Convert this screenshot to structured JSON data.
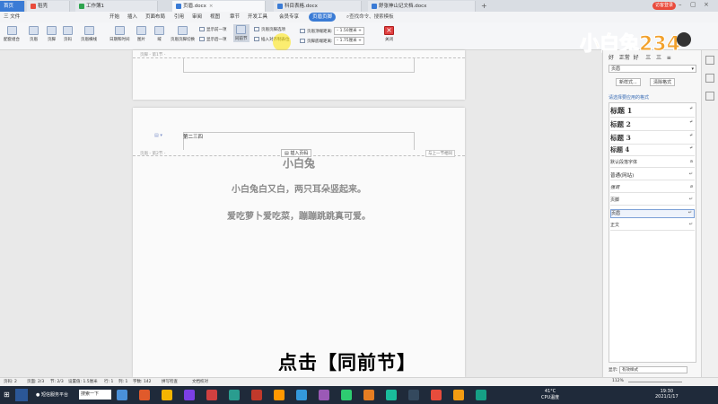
{
  "tabs": [
    {
      "label": "首页",
      "active": false,
      "color": "#3a7bd5"
    },
    {
      "label": "稻壳",
      "active": false,
      "color": "#e94b3c"
    },
    {
      "label": "工作簿1",
      "active": false,
      "color": "#2ea44f"
    },
    {
      "label": "页眉.docx",
      "active": true,
      "color": "#3a7bd5"
    },
    {
      "label": "科目表格.docx",
      "active": false,
      "color": "#3a7bd5"
    },
    {
      "label": "舒张神山记文档.docx",
      "active": false,
      "color": "#3a7bd5"
    }
  ],
  "user_badge": "访客登录",
  "menus": [
    "三 文件",
    "开始",
    "插入",
    "页面布局",
    "引用",
    "审阅",
    "视图",
    "章节",
    "开发工具",
    "会员专享",
    "页眉页脚"
  ],
  "search_placeholder": "查找命令、搜索模板",
  "ribbon": {
    "big": [
      "配套组合",
      "页眉",
      "页脚",
      "页码",
      "页眉横线",
      "日期和时间",
      "图片",
      "域",
      "页眉页脚切换",
      "同前节",
      "关闭"
    ],
    "show_prev": "显示前一项",
    "show_next": "显示后一项",
    "hf_options": "页眉页脚选项",
    "insert_align": "插入对齐制表位",
    "header_top_label": "页眉顶端距离:",
    "header_top_value": "1.50厘米",
    "footer_bottom_label": "页脚底端距离:",
    "footer_bottom_value": "1.75厘米"
  },
  "doc": {
    "footer_label_1": "页脚 - 第1节 -",
    "header_label_2": "页眉 - 第2节 -",
    "header_text": "第二三四",
    "insert_page_num": "插入页码",
    "same_as_prev": "与上一节相同",
    "title": "小白兔",
    "lines": [
      "小白兔白又白，两只耳朵竖起来。",
      "爱吃萝卜爱吃菜，蹦蹦跳跳真可爱。"
    ]
  },
  "panel": {
    "top_labels": [
      "好",
      "正常",
      "好",
      "三",
      "三",
      "≡"
    ],
    "style_select": "页眉",
    "new_style": "新样式...",
    "clear_format": "清除格式",
    "section_title": "请选择要应用的格式",
    "styles": [
      "标题 1",
      "标题 2",
      "标题 3",
      "标题 4",
      "默认段落字体",
      "普通(网站)",
      "强调",
      "页脚",
      "页眉",
      "正文"
    ],
    "show_label": "显示:",
    "show_value": "有效样式"
  },
  "logo_text": "小白兔234",
  "status": [
    "页码: 2",
    "页面: 2/3",
    "节: 2/3",
    "设置值: 1.5厘米",
    "行: 1",
    "列: 1",
    "字数: 142",
    "拼写检查",
    "文档校对"
  ],
  "zoom": "112%",
  "caption": "点击【同前节】",
  "taskbar": {
    "search_text": "搜索一下",
    "app_text": "短信服务平台",
    "temp": "41°C",
    "temp_label": "CPU温度",
    "time": "19:30",
    "date": "2021/1/17",
    "icon_colors": [
      "#4a90d9",
      "#e05a2b",
      "#f4b400",
      "#7b3fe4",
      "#d04040",
      "#2a9d8f",
      "#c0392b",
      "#ff9800",
      "#3498db",
      "#9b59b6",
      "#2ecc71",
      "#e67e22",
      "#1abc9c",
      "#34495e",
      "#e74c3c",
      "#f39c12",
      "#16a085"
    ]
  }
}
